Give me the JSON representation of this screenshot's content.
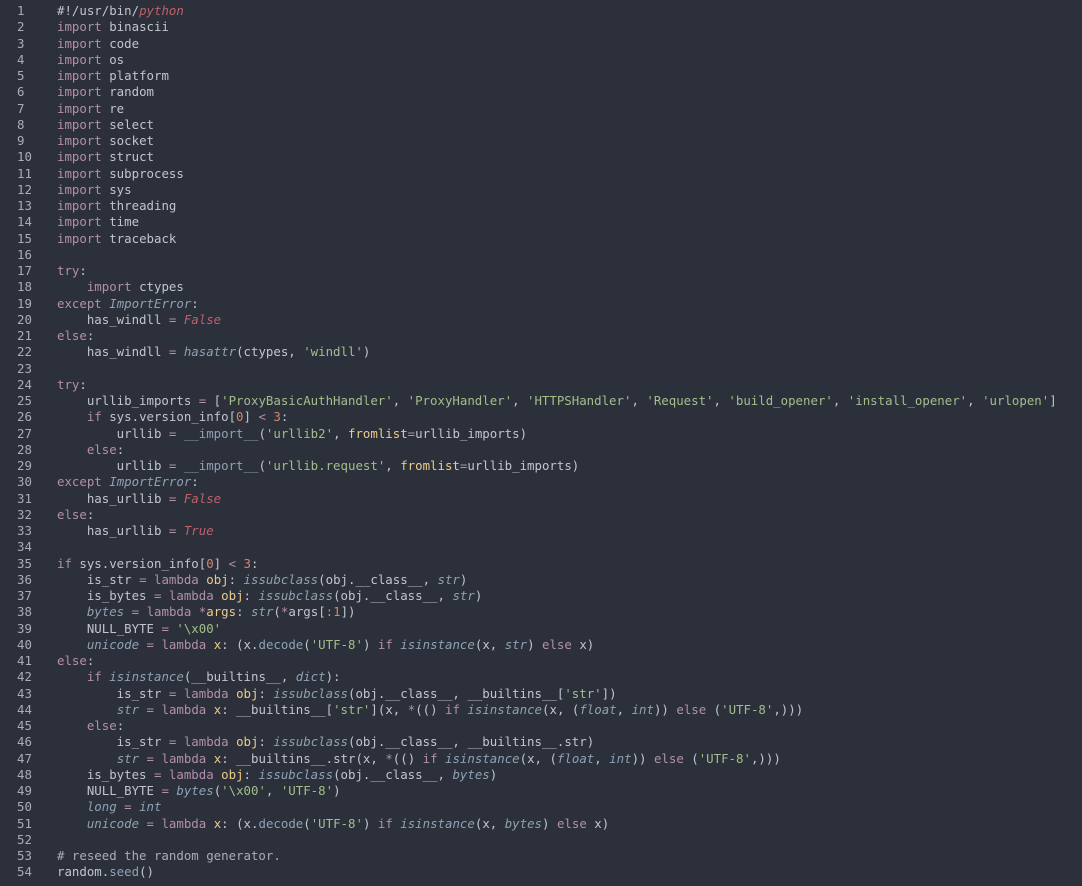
{
  "lines": [
    [
      [
        "pl",
        "#!/usr/bin/"
      ],
      [
        "err",
        "python"
      ]
    ],
    [
      [
        "kw",
        "import"
      ],
      [
        "pl",
        " binascii"
      ]
    ],
    [
      [
        "kw",
        "import"
      ],
      [
        "pl",
        " code"
      ]
    ],
    [
      [
        "kw",
        "import"
      ],
      [
        "pl",
        " os"
      ]
    ],
    [
      [
        "kw",
        "import"
      ],
      [
        "pl",
        " platform"
      ]
    ],
    [
      [
        "kw",
        "import"
      ],
      [
        "pl",
        " random"
      ]
    ],
    [
      [
        "kw",
        "import"
      ],
      [
        "pl",
        " re"
      ]
    ],
    [
      [
        "kw",
        "import"
      ],
      [
        "pl",
        " select"
      ]
    ],
    [
      [
        "kw",
        "import"
      ],
      [
        "pl",
        " socket"
      ]
    ],
    [
      [
        "kw",
        "import"
      ],
      [
        "pl",
        " struct"
      ]
    ],
    [
      [
        "kw",
        "import"
      ],
      [
        "pl",
        " subprocess"
      ]
    ],
    [
      [
        "kw",
        "import"
      ],
      [
        "pl",
        " sys"
      ]
    ],
    [
      [
        "kw",
        "import"
      ],
      [
        "pl",
        " threading"
      ]
    ],
    [
      [
        "kw",
        "import"
      ],
      [
        "pl",
        " time"
      ]
    ],
    [
      [
        "kw",
        "import"
      ],
      [
        "pl",
        " traceback"
      ]
    ],
    [],
    [
      [
        "kw",
        "try"
      ],
      [
        "pl",
        ":"
      ]
    ],
    [
      [
        "pl",
        "    "
      ],
      [
        "kw",
        "import"
      ],
      [
        "pl",
        " ctypes"
      ]
    ],
    [
      [
        "kw",
        "except"
      ],
      [
        "pl",
        " "
      ],
      [
        "cls",
        "ImportError"
      ],
      [
        "pl",
        ":"
      ]
    ],
    [
      [
        "pl",
        "    has_windll "
      ],
      [
        "kw",
        "="
      ],
      [
        "pl",
        " "
      ],
      [
        "const",
        "False"
      ]
    ],
    [
      [
        "kw",
        "else"
      ],
      [
        "pl",
        ":"
      ]
    ],
    [
      [
        "pl",
        "    has_windll "
      ],
      [
        "kw",
        "="
      ],
      [
        "pl",
        " "
      ],
      [
        "fn",
        "hasattr"
      ],
      [
        "pl",
        "(ctypes, "
      ],
      [
        "str",
        "'windll'"
      ],
      [
        "pl",
        ")"
      ]
    ],
    [],
    [
      [
        "kw",
        "try"
      ],
      [
        "pl",
        ":"
      ]
    ],
    [
      [
        "pl",
        "    urllib_imports "
      ],
      [
        "kw",
        "="
      ],
      [
        "pl",
        " ["
      ],
      [
        "str",
        "'ProxyBasicAuthHandler'"
      ],
      [
        "pl",
        ", "
      ],
      [
        "str",
        "'ProxyHandler'"
      ],
      [
        "pl",
        ", "
      ],
      [
        "str",
        "'HTTPSHandler'"
      ],
      [
        "pl",
        ", "
      ],
      [
        "str",
        "'Request'"
      ],
      [
        "pl",
        ", "
      ],
      [
        "str",
        "'build_opener'"
      ],
      [
        "pl",
        ", "
      ],
      [
        "str",
        "'install_opener'"
      ],
      [
        "pl",
        ", "
      ],
      [
        "str",
        "'urlopen'"
      ],
      [
        "pl",
        "]"
      ]
    ],
    [
      [
        "pl",
        "    "
      ],
      [
        "kw",
        "if"
      ],
      [
        "pl",
        " sys.version_info["
      ],
      [
        "num",
        "0"
      ],
      [
        "pl",
        "] "
      ],
      [
        "kw",
        "<"
      ],
      [
        "pl",
        " "
      ],
      [
        "num",
        "3"
      ],
      [
        "pl",
        ":"
      ]
    ],
    [
      [
        "pl",
        "        urllib "
      ],
      [
        "kw",
        "="
      ],
      [
        "pl",
        " "
      ],
      [
        "meth",
        "__import__"
      ],
      [
        "pl",
        "("
      ],
      [
        "str",
        "'urllib2'"
      ],
      [
        "pl",
        ", "
      ],
      [
        "param",
        "fromlist"
      ],
      [
        "kw",
        "="
      ],
      [
        "pl",
        "urllib_imports)"
      ]
    ],
    [
      [
        "pl",
        "    "
      ],
      [
        "kw",
        "else"
      ],
      [
        "pl",
        ":"
      ]
    ],
    [
      [
        "pl",
        "        urllib "
      ],
      [
        "kw",
        "="
      ],
      [
        "pl",
        " "
      ],
      [
        "meth",
        "__import__"
      ],
      [
        "pl",
        "("
      ],
      [
        "str",
        "'urllib.request'"
      ],
      [
        "pl",
        ", "
      ],
      [
        "param",
        "fromlist"
      ],
      [
        "kw",
        "="
      ],
      [
        "pl",
        "urllib_imports)"
      ]
    ],
    [
      [
        "kw",
        "except"
      ],
      [
        "pl",
        " "
      ],
      [
        "cls",
        "ImportError"
      ],
      [
        "pl",
        ":"
      ]
    ],
    [
      [
        "pl",
        "    has_urllib "
      ],
      [
        "kw",
        "="
      ],
      [
        "pl",
        " "
      ],
      [
        "const",
        "False"
      ]
    ],
    [
      [
        "kw",
        "else"
      ],
      [
        "pl",
        ":"
      ]
    ],
    [
      [
        "pl",
        "    has_urllib "
      ],
      [
        "kw",
        "="
      ],
      [
        "pl",
        " "
      ],
      [
        "const",
        "True"
      ]
    ],
    [],
    [
      [
        "kw",
        "if"
      ],
      [
        "pl",
        " sys.version_info["
      ],
      [
        "num",
        "0"
      ],
      [
        "pl",
        "] "
      ],
      [
        "kw",
        "<"
      ],
      [
        "pl",
        " "
      ],
      [
        "num",
        "3"
      ],
      [
        "pl",
        ":"
      ]
    ],
    [
      [
        "pl",
        "    is_str "
      ],
      [
        "kw",
        "="
      ],
      [
        "pl",
        " "
      ],
      [
        "kw",
        "lambda"
      ],
      [
        "pl",
        " "
      ],
      [
        "param",
        "obj"
      ],
      [
        "pl",
        ": "
      ],
      [
        "fn",
        "issubclass"
      ],
      [
        "pl",
        "(obj.__class__, "
      ],
      [
        "fn",
        "str"
      ],
      [
        "pl",
        ")"
      ]
    ],
    [
      [
        "pl",
        "    is_bytes "
      ],
      [
        "kw",
        "="
      ],
      [
        "pl",
        " "
      ],
      [
        "kw",
        "lambda"
      ],
      [
        "pl",
        " "
      ],
      [
        "param",
        "obj"
      ],
      [
        "pl",
        ": "
      ],
      [
        "fn",
        "issubclass"
      ],
      [
        "pl",
        "(obj.__class__, "
      ],
      [
        "fn",
        "str"
      ],
      [
        "pl",
        ")"
      ]
    ],
    [
      [
        "pl",
        "    "
      ],
      [
        "var",
        "bytes"
      ],
      [
        "pl",
        " "
      ],
      [
        "kw",
        "="
      ],
      [
        "pl",
        " "
      ],
      [
        "kw",
        "lambda"
      ],
      [
        "pl",
        " "
      ],
      [
        "kw",
        "*"
      ],
      [
        "param",
        "args"
      ],
      [
        "pl",
        ": "
      ],
      [
        "fn",
        "str"
      ],
      [
        "pl",
        "("
      ],
      [
        "kw",
        "*"
      ],
      [
        "pl",
        "args["
      ],
      [
        "num",
        ":1"
      ],
      [
        "pl",
        "])"
      ]
    ],
    [
      [
        "pl",
        "    NULL_BYTE "
      ],
      [
        "kw",
        "="
      ],
      [
        "pl",
        " "
      ],
      [
        "str",
        "'\\x00'"
      ]
    ],
    [
      [
        "pl",
        "    "
      ],
      [
        "var",
        "unicode"
      ],
      [
        "pl",
        " "
      ],
      [
        "kw",
        "="
      ],
      [
        "pl",
        " "
      ],
      [
        "kw",
        "lambda"
      ],
      [
        "pl",
        " "
      ],
      [
        "param",
        "x"
      ],
      [
        "pl",
        ": (x."
      ],
      [
        "meth",
        "decode"
      ],
      [
        "pl",
        "("
      ],
      [
        "str",
        "'UTF-8'"
      ],
      [
        "pl",
        ") "
      ],
      [
        "kw",
        "if"
      ],
      [
        "pl",
        " "
      ],
      [
        "fn",
        "isinstance"
      ],
      [
        "pl",
        "(x, "
      ],
      [
        "fn",
        "str"
      ],
      [
        "pl",
        ") "
      ],
      [
        "kw",
        "else"
      ],
      [
        "pl",
        " x)"
      ]
    ],
    [
      [
        "kw",
        "else"
      ],
      [
        "pl",
        ":"
      ]
    ],
    [
      [
        "pl",
        "    "
      ],
      [
        "kw",
        "if"
      ],
      [
        "pl",
        " "
      ],
      [
        "fn",
        "isinstance"
      ],
      [
        "pl",
        "(__builtins__, "
      ],
      [
        "fn",
        "dict"
      ],
      [
        "pl",
        "):"
      ]
    ],
    [
      [
        "pl",
        "        is_str "
      ],
      [
        "kw",
        "="
      ],
      [
        "pl",
        " "
      ],
      [
        "kw",
        "lambda"
      ],
      [
        "pl",
        " "
      ],
      [
        "param",
        "obj"
      ],
      [
        "pl",
        ": "
      ],
      [
        "fn",
        "issubclass"
      ],
      [
        "pl",
        "(obj.__class__, __builtins__["
      ],
      [
        "str",
        "'str'"
      ],
      [
        "pl",
        "])"
      ]
    ],
    [
      [
        "pl",
        "        "
      ],
      [
        "var",
        "str"
      ],
      [
        "pl",
        " "
      ],
      [
        "kw",
        "="
      ],
      [
        "pl",
        " "
      ],
      [
        "kw",
        "lambda"
      ],
      [
        "pl",
        " "
      ],
      [
        "param",
        "x"
      ],
      [
        "pl",
        ": __builtins__["
      ],
      [
        "str",
        "'str'"
      ],
      [
        "pl",
        "](x, "
      ],
      [
        "kw",
        "*"
      ],
      [
        "pl",
        "(() "
      ],
      [
        "kw",
        "if"
      ],
      [
        "pl",
        " "
      ],
      [
        "fn",
        "isinstance"
      ],
      [
        "pl",
        "(x, ("
      ],
      [
        "fn",
        "float"
      ],
      [
        "pl",
        ", "
      ],
      [
        "fn",
        "int"
      ],
      [
        "pl",
        ")) "
      ],
      [
        "kw",
        "else"
      ],
      [
        "pl",
        " ("
      ],
      [
        "str",
        "'UTF-8'"
      ],
      [
        "pl",
        ",)))"
      ]
    ],
    [
      [
        "pl",
        "    "
      ],
      [
        "kw",
        "else"
      ],
      [
        "pl",
        ":"
      ]
    ],
    [
      [
        "pl",
        "        is_str "
      ],
      [
        "kw",
        "="
      ],
      [
        "pl",
        " "
      ],
      [
        "kw",
        "lambda"
      ],
      [
        "pl",
        " "
      ],
      [
        "param",
        "obj"
      ],
      [
        "pl",
        ": "
      ],
      [
        "fn",
        "issubclass"
      ],
      [
        "pl",
        "(obj.__class__, __builtins__.str)"
      ]
    ],
    [
      [
        "pl",
        "        "
      ],
      [
        "var",
        "str"
      ],
      [
        "pl",
        " "
      ],
      [
        "kw",
        "="
      ],
      [
        "pl",
        " "
      ],
      [
        "kw",
        "lambda"
      ],
      [
        "pl",
        " "
      ],
      [
        "param",
        "x"
      ],
      [
        "pl",
        ": __builtins__.str(x, "
      ],
      [
        "kw",
        "*"
      ],
      [
        "pl",
        "(() "
      ],
      [
        "kw",
        "if"
      ],
      [
        "pl",
        " "
      ],
      [
        "fn",
        "isinstance"
      ],
      [
        "pl",
        "(x, ("
      ],
      [
        "fn",
        "float"
      ],
      [
        "pl",
        ", "
      ],
      [
        "fn",
        "int"
      ],
      [
        "pl",
        ")) "
      ],
      [
        "kw",
        "else"
      ],
      [
        "pl",
        " ("
      ],
      [
        "str",
        "'UTF-8'"
      ],
      [
        "pl",
        ",)))"
      ]
    ],
    [
      [
        "pl",
        "    is_bytes "
      ],
      [
        "kw",
        "="
      ],
      [
        "pl",
        " "
      ],
      [
        "kw",
        "lambda"
      ],
      [
        "pl",
        " "
      ],
      [
        "param",
        "obj"
      ],
      [
        "pl",
        ": "
      ],
      [
        "fn",
        "issubclass"
      ],
      [
        "pl",
        "(obj.__class__, "
      ],
      [
        "fn",
        "bytes"
      ],
      [
        "pl",
        ")"
      ]
    ],
    [
      [
        "pl",
        "    NULL_BYTE "
      ],
      [
        "kw",
        "="
      ],
      [
        "pl",
        " "
      ],
      [
        "fn",
        "bytes"
      ],
      [
        "pl",
        "("
      ],
      [
        "str",
        "'\\x00'"
      ],
      [
        "pl",
        ", "
      ],
      [
        "str",
        "'UTF-8'"
      ],
      [
        "pl",
        ")"
      ]
    ],
    [
      [
        "pl",
        "    "
      ],
      [
        "var",
        "long"
      ],
      [
        "pl",
        " "
      ],
      [
        "kw",
        "="
      ],
      [
        "pl",
        " "
      ],
      [
        "fn",
        "int"
      ]
    ],
    [
      [
        "pl",
        "    "
      ],
      [
        "var",
        "unicode"
      ],
      [
        "pl",
        " "
      ],
      [
        "kw",
        "="
      ],
      [
        "pl",
        " "
      ],
      [
        "kw",
        "lambda"
      ],
      [
        "pl",
        " "
      ],
      [
        "param",
        "x"
      ],
      [
        "pl",
        ": (x."
      ],
      [
        "meth",
        "decode"
      ],
      [
        "pl",
        "("
      ],
      [
        "str",
        "'UTF-8'"
      ],
      [
        "pl",
        ") "
      ],
      [
        "kw",
        "if"
      ],
      [
        "pl",
        " "
      ],
      [
        "fn",
        "isinstance"
      ],
      [
        "pl",
        "(x, "
      ],
      [
        "fn",
        "bytes"
      ],
      [
        "pl",
        ") "
      ],
      [
        "kw",
        "else"
      ],
      [
        "pl",
        " x)"
      ]
    ],
    [],
    [
      [
        "cm",
        "# reseed the random generator."
      ]
    ],
    [
      [
        "pl",
        "random."
      ],
      [
        "meth",
        "seed"
      ],
      [
        "pl",
        "()"
      ]
    ]
  ],
  "colors": {
    "background": "#2b303b",
    "text": "#c0c5ce",
    "keyword": "#b48ead",
    "string": "#a3be8c",
    "number": "#d08770",
    "builtin": "#8fa1b3",
    "constant": "#bf616a",
    "parameter": "#ebcb8b",
    "comment": "#a8adb6"
  }
}
